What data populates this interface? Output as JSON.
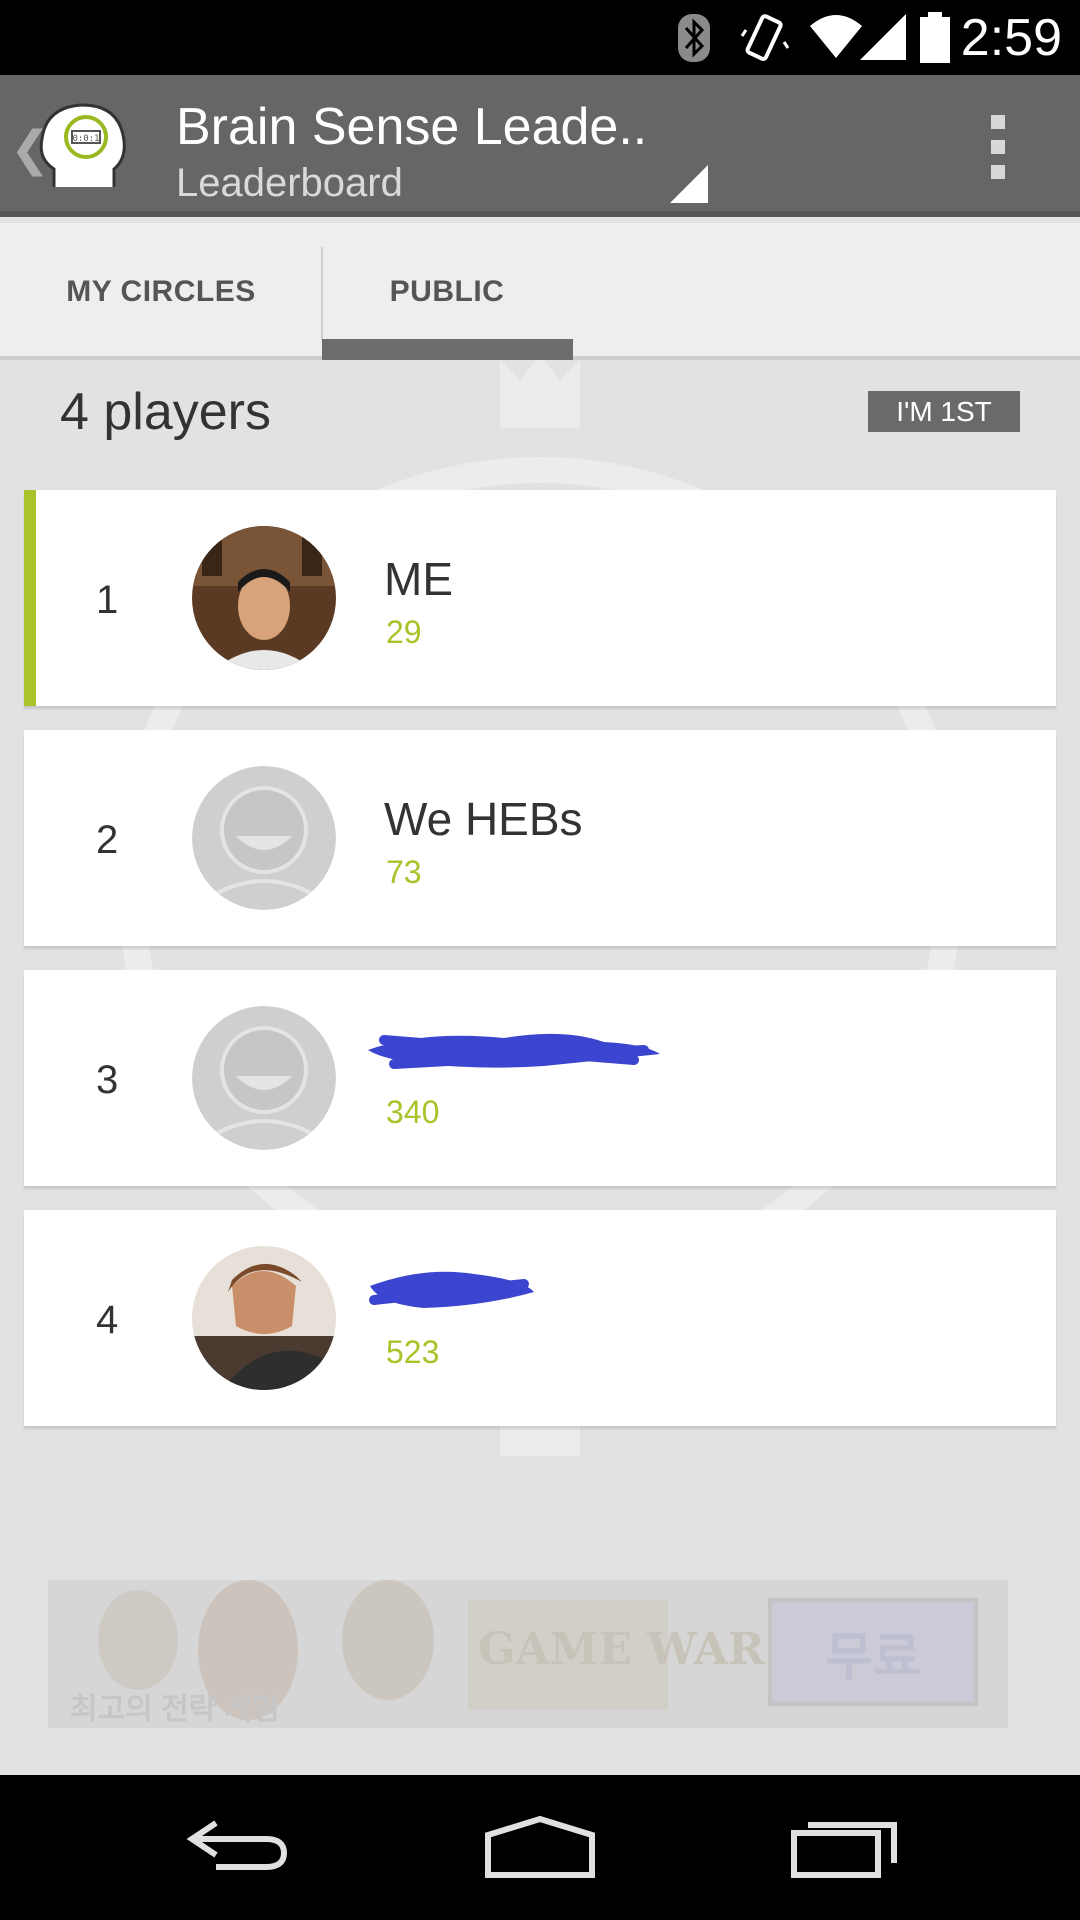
{
  "status_bar": {
    "time": "2:59",
    "icons": [
      "bluetooth-icon",
      "vibrate-icon",
      "wifi-icon",
      "signal-icon",
      "battery-icon"
    ]
  },
  "action_bar": {
    "title": "Brain Sense Leade..",
    "subtitle": "Leaderboard",
    "icons": [
      "up-caret-icon",
      "app-logo-icon",
      "spinner-dropdown-icon",
      "overflow-menu-icon"
    ]
  },
  "tabs": [
    {
      "label": "MY CIRCLES",
      "selected": false
    },
    {
      "label": "PUBLIC",
      "selected": true
    }
  ],
  "leaderboard": {
    "players_count": "4 players",
    "jump_button": "I'M 1ST",
    "rows": [
      {
        "rank": "1",
        "name": "ME",
        "score": "29",
        "highlighted": true
      },
      {
        "rank": "2",
        "name": "We HEBs",
        "score": "73",
        "highlighted": false
      },
      {
        "rank": "3",
        "name": "",
        "score": "340",
        "highlighted": false
      },
      {
        "rank": "4",
        "name": "",
        "score": "523",
        "highlighted": false
      }
    ]
  },
  "ad": {
    "left_text": "최고의 전략 게임",
    "logo_text": "GAME WAR",
    "button_text": "무료"
  },
  "nav_bar": {
    "icons": [
      "back-icon",
      "home-icon",
      "recents-icon"
    ]
  },
  "colors": {
    "accent": "#a9c32a",
    "action_bar": "#666666",
    "tab_indicator": "#6d6d6d"
  }
}
